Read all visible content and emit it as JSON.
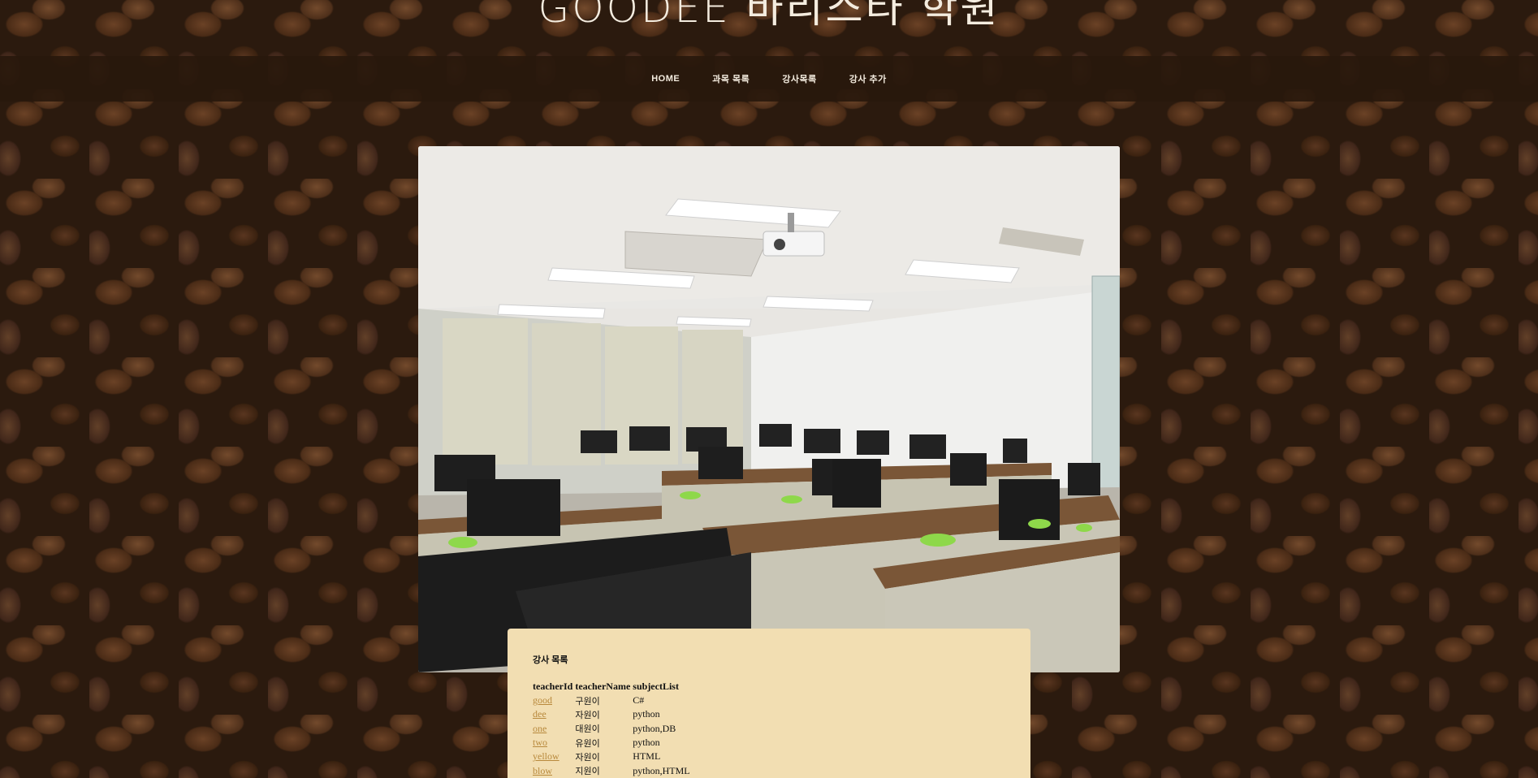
{
  "site": {
    "title": "GOODEE 바리스타 학원"
  },
  "nav": {
    "items": [
      {
        "label": "HOME",
        "name": "nav-home"
      },
      {
        "label": "과목 목록",
        "name": "nav-subject-list"
      },
      {
        "label": "강사목록",
        "name": "nav-teacher-list"
      },
      {
        "label": "강사 추가",
        "name": "nav-add-teacher"
      }
    ]
  },
  "colors": {
    "panel_bg": "#f2deb2",
    "link": "#b8893c",
    "nav_bg": "#28180c",
    "nav_text": "#f4ecdf"
  },
  "teacher_list": {
    "title": "강사 목록",
    "headers": [
      "teacherId",
      "teacherName",
      "subjectList"
    ],
    "rows": [
      {
        "id": "good",
        "name": "구원이",
        "subjects": "C#"
      },
      {
        "id": "dee",
        "name": "자원이",
        "subjects": "python"
      },
      {
        "id": "one",
        "name": "대원이",
        "subjects": "python,DB"
      },
      {
        "id": "two",
        "name": "유원이",
        "subjects": "python"
      },
      {
        "id": "yellow",
        "name": "자원이",
        "subjects": "HTML"
      },
      {
        "id": "blow",
        "name": "지원이",
        "subjects": "python,HTML"
      }
    ]
  }
}
